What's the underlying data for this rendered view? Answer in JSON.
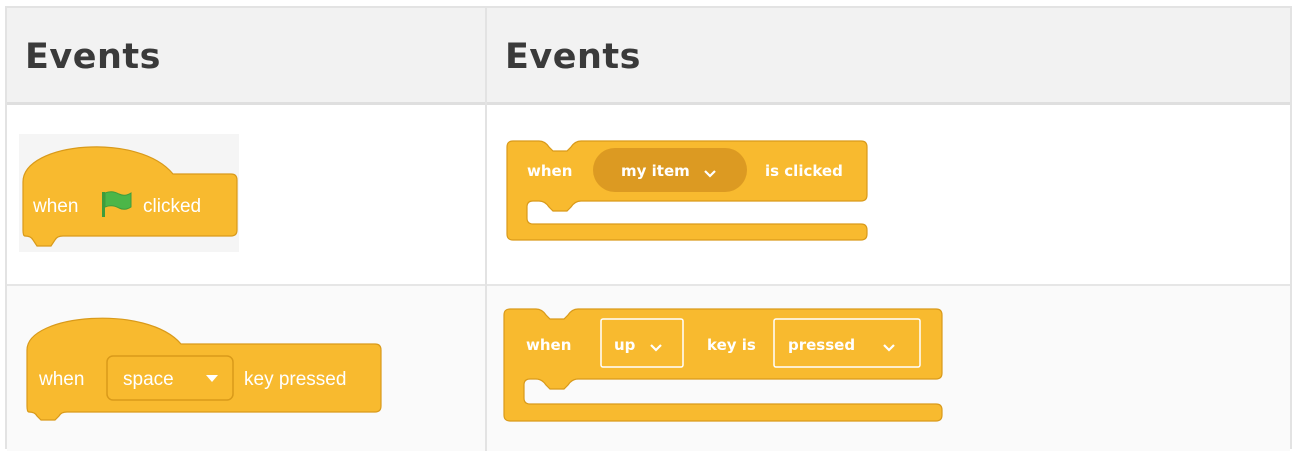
{
  "header": {
    "left_title": "Events",
    "right_title": "Events"
  },
  "rows": [
    {
      "left_block": {
        "prefix": "when",
        "icon": "green-flag-icon",
        "suffix": "clicked"
      },
      "right_block": {
        "prefix": "when",
        "dropdown": "my item",
        "suffix": "is clicked"
      }
    },
    {
      "left_block": {
        "prefix": "when",
        "dropdown": "space",
        "suffix": "key pressed"
      },
      "right_block": {
        "prefix": "when",
        "dropdown1": "up",
        "middle": "key is",
        "dropdown2": "pressed"
      }
    }
  ],
  "colors": {
    "block_fill": "#f8ba2f",
    "block_stroke": "#d99a1a",
    "dropdown_dark": "#dc9a22",
    "flag_green": "#4cb648",
    "header_bg": "#f2f2f2",
    "header_text": "#3a3a3a"
  }
}
